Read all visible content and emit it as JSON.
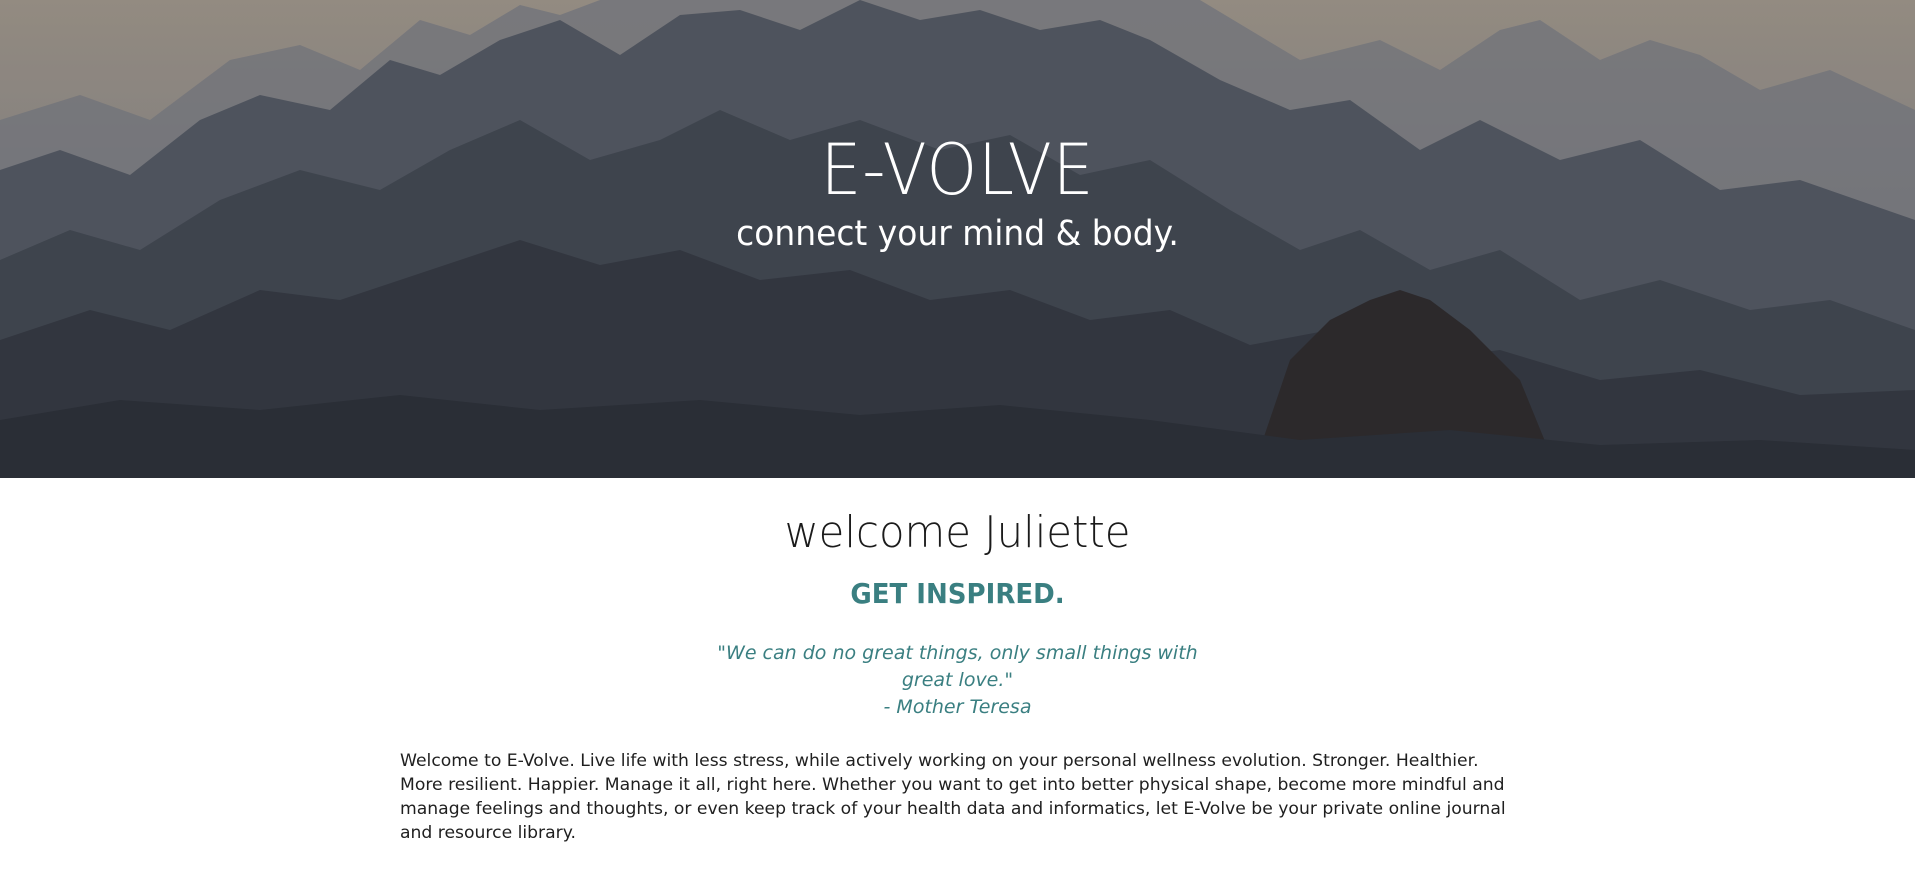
{
  "hero": {
    "title": "E-VOLVE",
    "subtitle": "connect your mind & body."
  },
  "welcome": {
    "heading": "welcome Juliette"
  },
  "inspiration": {
    "heading": "GET INSPIRED.",
    "quote_line1": "\"We can do no great things, only small things with",
    "quote_line2": "great love.\"",
    "attribution": "- Mother Teresa"
  },
  "intro": {
    "text": "Welcome to E-Volve. Live life with less stress, while actively working on your personal wellness evolution. Stronger. Healthier. More resilient. Happier. Manage it all, right here. Whether you want to get into better physical shape, become more mindful and manage feelings and thoughts, or even keep track of your health data and informatics, let E-Volve be your private online journal and resource library."
  },
  "colors": {
    "accent": "#3a7f81",
    "text": "#1f1f1f",
    "hero_text": "#ffffff"
  }
}
